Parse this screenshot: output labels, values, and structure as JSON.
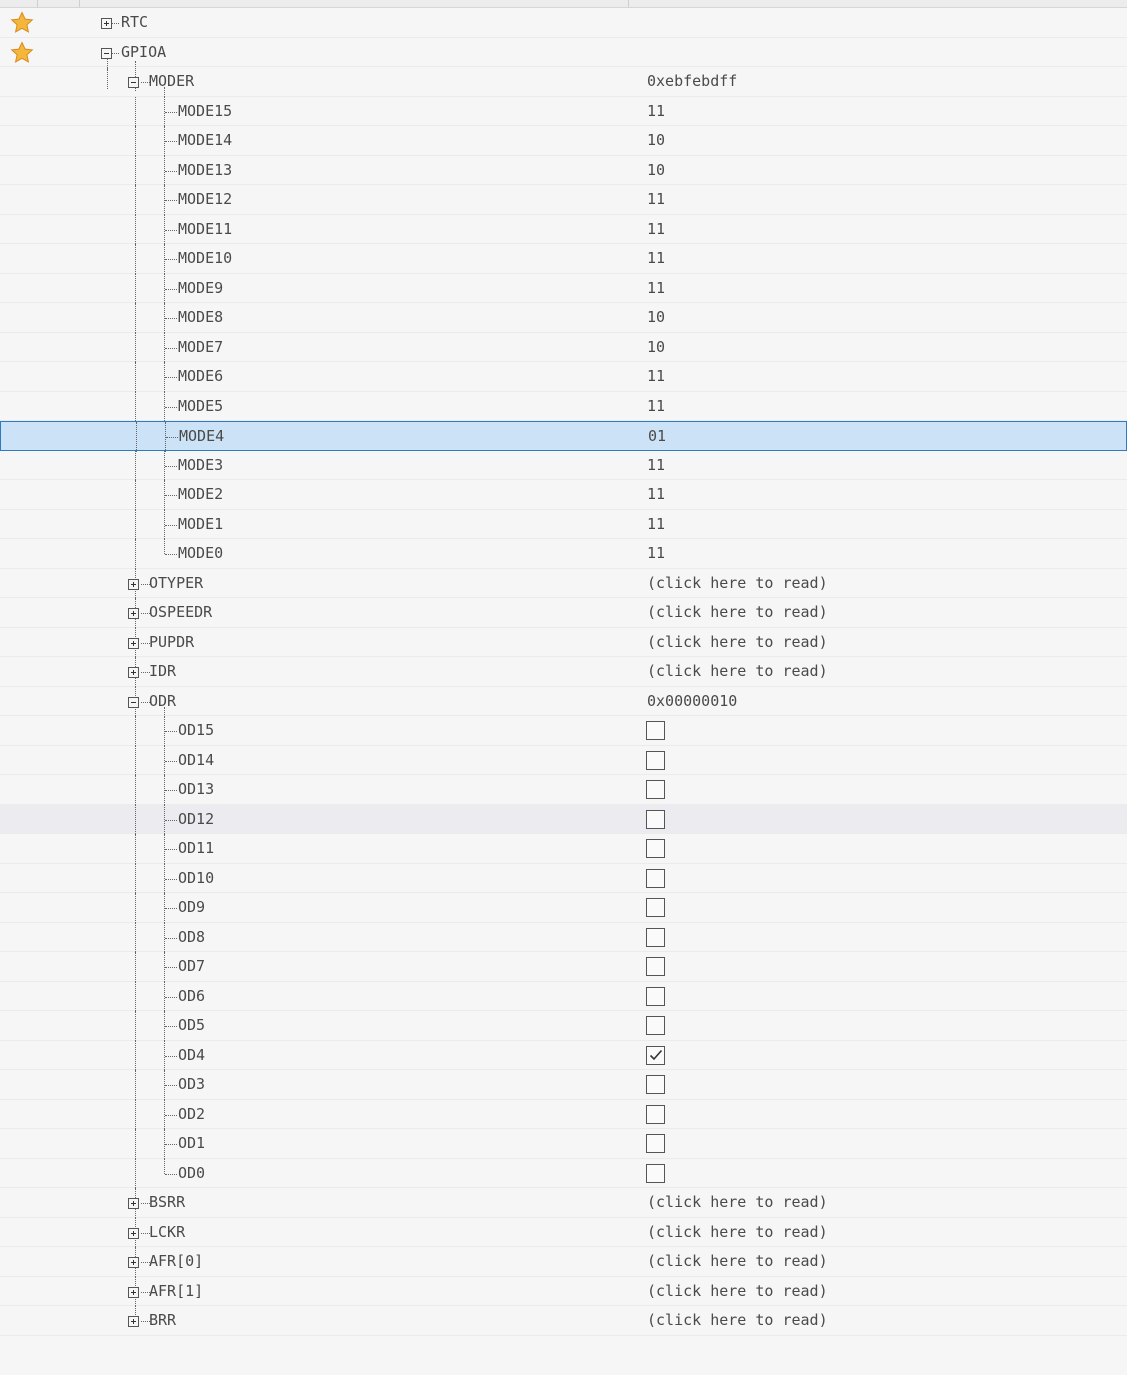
{
  "tree": [
    {
      "label": "RTC",
      "level": 0,
      "type": "collapsed",
      "starred": true,
      "value": ""
    },
    {
      "label": "GPIOA",
      "level": 0,
      "type": "expanded",
      "starred": true,
      "value": ""
    },
    {
      "label": "MODER",
      "level": 1,
      "type": "expanded",
      "value": "0xebfebdff"
    },
    {
      "label": "MODE15",
      "level": 2,
      "type": "leaf",
      "value": "11"
    },
    {
      "label": "MODE14",
      "level": 2,
      "type": "leaf",
      "value": "10"
    },
    {
      "label": "MODE13",
      "level": 2,
      "type": "leaf",
      "value": "10"
    },
    {
      "label": "MODE12",
      "level": 2,
      "type": "leaf",
      "value": "11"
    },
    {
      "label": "MODE11",
      "level": 2,
      "type": "leaf",
      "value": "11"
    },
    {
      "label": "MODE10",
      "level": 2,
      "type": "leaf",
      "value": "11"
    },
    {
      "label": "MODE9",
      "level": 2,
      "type": "leaf",
      "value": "11"
    },
    {
      "label": "MODE8",
      "level": 2,
      "type": "leaf",
      "value": "10"
    },
    {
      "label": "MODE7",
      "level": 2,
      "type": "leaf",
      "value": "10"
    },
    {
      "label": "MODE6",
      "level": 2,
      "type": "leaf",
      "value": "11"
    },
    {
      "label": "MODE5",
      "level": 2,
      "type": "leaf",
      "value": "11"
    },
    {
      "label": "MODE4",
      "level": 2,
      "type": "leaf",
      "value": "01",
      "selected": true
    },
    {
      "label": "MODE3",
      "level": 2,
      "type": "leaf",
      "value": "11"
    },
    {
      "label": "MODE2",
      "level": 2,
      "type": "leaf",
      "value": "11"
    },
    {
      "label": "MODE1",
      "level": 2,
      "type": "leaf",
      "value": "11"
    },
    {
      "label": "MODE0",
      "level": 2,
      "type": "leaf",
      "value": "11",
      "last": true
    },
    {
      "label": "OTYPER",
      "level": 1,
      "type": "collapsed",
      "value": "(click here to read)"
    },
    {
      "label": "OSPEEDR",
      "level": 1,
      "type": "collapsed",
      "value": "(click here to read)"
    },
    {
      "label": "PUPDR",
      "level": 1,
      "type": "collapsed",
      "value": "(click here to read)"
    },
    {
      "label": "IDR",
      "level": 1,
      "type": "collapsed",
      "value": "(click here to read)"
    },
    {
      "label": "ODR",
      "level": 1,
      "type": "expanded",
      "value": "0x00000010"
    },
    {
      "label": "OD15",
      "level": 2,
      "type": "leaf",
      "checkbox": false
    },
    {
      "label": "OD14",
      "level": 2,
      "type": "leaf",
      "checkbox": false
    },
    {
      "label": "OD13",
      "level": 2,
      "type": "leaf",
      "checkbox": false
    },
    {
      "label": "OD12",
      "level": 2,
      "type": "leaf",
      "checkbox": false,
      "hover": true
    },
    {
      "label": "OD11",
      "level": 2,
      "type": "leaf",
      "checkbox": false
    },
    {
      "label": "OD10",
      "level": 2,
      "type": "leaf",
      "checkbox": false
    },
    {
      "label": "OD9",
      "level": 2,
      "type": "leaf",
      "checkbox": false
    },
    {
      "label": "OD8",
      "level": 2,
      "type": "leaf",
      "checkbox": false
    },
    {
      "label": "OD7",
      "level": 2,
      "type": "leaf",
      "checkbox": false
    },
    {
      "label": "OD6",
      "level": 2,
      "type": "leaf",
      "checkbox": false
    },
    {
      "label": "OD5",
      "level": 2,
      "type": "leaf",
      "checkbox": false
    },
    {
      "label": "OD4",
      "level": 2,
      "type": "leaf",
      "checkbox": true
    },
    {
      "label": "OD3",
      "level": 2,
      "type": "leaf",
      "checkbox": false
    },
    {
      "label": "OD2",
      "level": 2,
      "type": "leaf",
      "checkbox": false
    },
    {
      "label": "OD1",
      "level": 2,
      "type": "leaf",
      "checkbox": false
    },
    {
      "label": "OD0",
      "level": 2,
      "type": "leaf",
      "checkbox": false,
      "last": true
    },
    {
      "label": "BSRR",
      "level": 1,
      "type": "collapsed",
      "value": "(click here to read)"
    },
    {
      "label": "LCKR",
      "level": 1,
      "type": "collapsed",
      "value": "(click here to read)"
    },
    {
      "label": "AFR[0]",
      "level": 1,
      "type": "collapsed",
      "value": "(click here to read)"
    },
    {
      "label": "AFR[1]",
      "level": 1,
      "type": "collapsed",
      "value": "(click here to read)"
    },
    {
      "label": "BRR",
      "level": 1,
      "type": "collapsed",
      "value": "(click here to read)",
      "last": true
    }
  ],
  "colors": {
    "selection": "#cce3f7",
    "selection_border": "#2f7bbf",
    "star": "#f5b73b"
  },
  "icons": {
    "favorite": "star-icon",
    "expand": "plus-box-icon",
    "collapse": "minus-box-icon",
    "checked": "checkmark-icon"
  }
}
